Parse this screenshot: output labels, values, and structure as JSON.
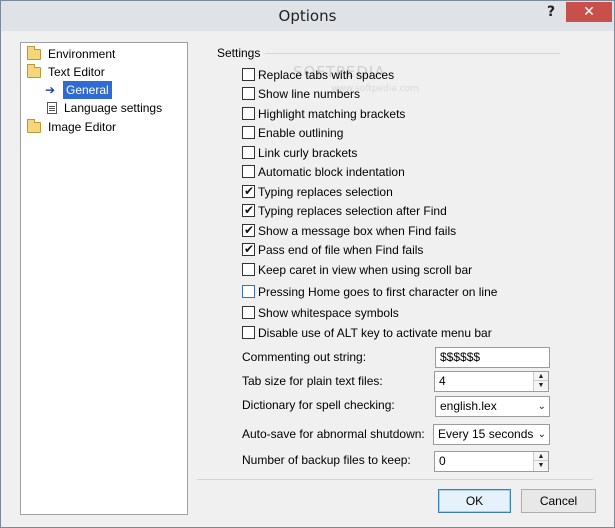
{
  "window": {
    "title": "Options",
    "help_label": "?",
    "close_label": "✕"
  },
  "tree": {
    "items": [
      {
        "label": "Environment",
        "icon": "folder-icon"
      },
      {
        "label": "Text Editor",
        "icon": "folder-open-icon"
      },
      {
        "label": "General",
        "icon": "arrow-right-icon",
        "selected": true
      },
      {
        "label": "Language settings",
        "icon": "document-icon"
      },
      {
        "label": "Image Editor",
        "icon": "folder-icon"
      }
    ]
  },
  "settings": {
    "group_label": "Settings",
    "checkboxes": [
      {
        "label": "Replace tabs with spaces",
        "checked": false
      },
      {
        "label": "Show line numbers",
        "checked": false
      },
      {
        "label": "Highlight matching brackets",
        "checked": false
      },
      {
        "label": "Enable outlining",
        "checked": false
      },
      {
        "label": "Link curly brackets",
        "checked": false
      },
      {
        "label": "Automatic block indentation",
        "checked": false
      },
      {
        "label": "Typing replaces selection",
        "checked": true
      },
      {
        "label": "Typing replaces selection after Find",
        "checked": true
      },
      {
        "label": "Show a message box when Find fails",
        "checked": true
      },
      {
        "label": "Pass end of file when Find fails",
        "checked": true
      },
      {
        "label": "Keep caret in view when using scroll bar",
        "checked": false
      },
      {
        "label": "Pressing Home goes to first character on line",
        "checked": false
      },
      {
        "label": "Show whitespace symbols",
        "checked": false
      },
      {
        "label": "Disable use of ALT key to activate menu bar",
        "checked": false
      }
    ],
    "fields": {
      "commenting": {
        "label": "Commenting out string:",
        "value": "$$$$$$"
      },
      "tab_size": {
        "label": "Tab size for plain text files:",
        "value": "4"
      },
      "dictionary": {
        "label": "Dictionary for spell checking:",
        "value": "english.lex"
      },
      "autosave": {
        "label": "Auto-save for abnormal shutdown:",
        "value": "Every 15 seconds"
      },
      "backups": {
        "label": "Number of backup files to keep:",
        "value": "0"
      }
    }
  },
  "buttons": {
    "ok": "OK",
    "cancel": "Cancel"
  },
  "watermark": {
    "main": "SOFTPEDIA",
    "sub": "www.softpedia.com"
  },
  "colors": {
    "selection": "#2f6bd0",
    "close_button": "#c7504b"
  }
}
